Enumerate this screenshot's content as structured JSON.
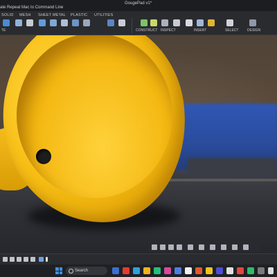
{
  "window": {
    "document_title": "GougePad v1*",
    "command_text": "ate Repeat Mac to Command Line"
  },
  "ribbon": {
    "tabs": [
      "SOLID",
      "MESH",
      "SHEET METAL",
      "PLASTIC",
      "UTILITIES"
    ],
    "groups": [
      "CONSTRUCT",
      "INSPECT",
      "INSERT",
      "SELECT"
    ],
    "left_group": "TE",
    "partial_group": "DESIGN"
  },
  "taskbar": {
    "search_label": "Search"
  },
  "colors": {
    "cup_yellow": "#f7be14",
    "ribbon_bg": "#2a2b2f",
    "machine_blue": "#2f57b5"
  }
}
